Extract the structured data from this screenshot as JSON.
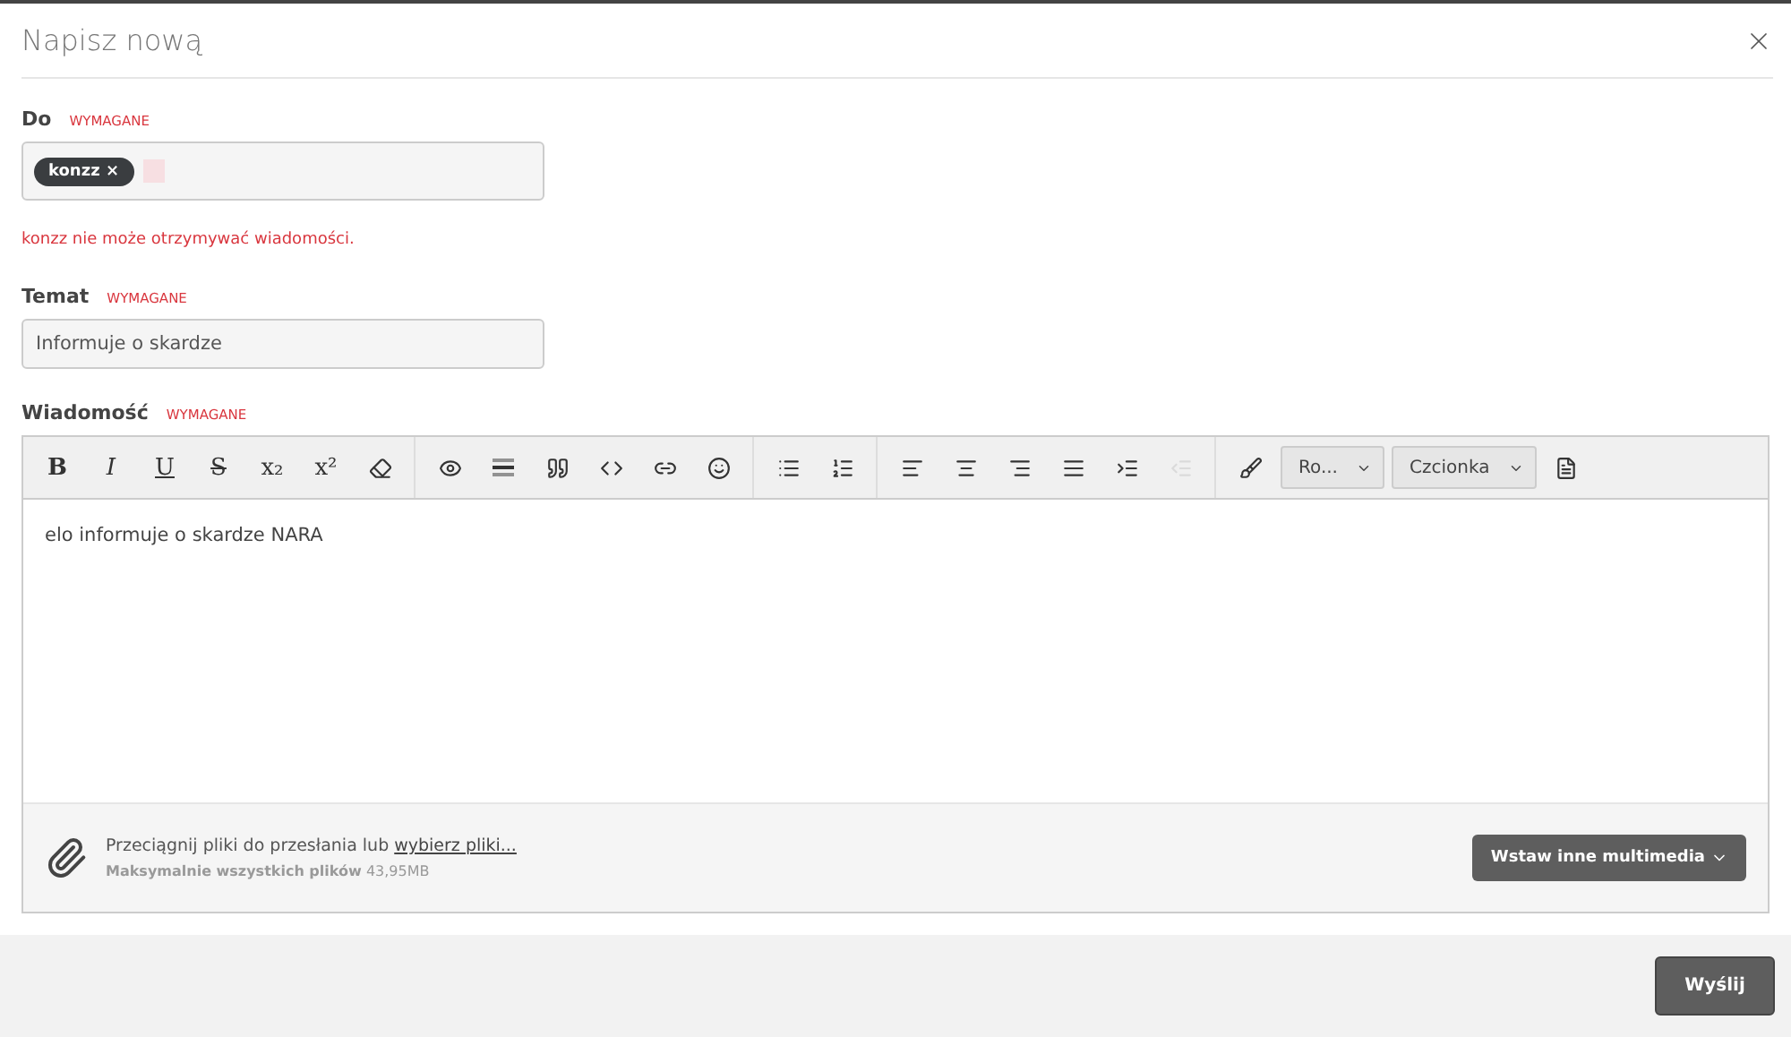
{
  "dialog": {
    "title": "Napisz nową"
  },
  "to": {
    "label": "Do",
    "required": "WYMAGANE",
    "chips": [
      {
        "label": "konzz ×"
      }
    ],
    "error": "konzz nie może otrzymywać wiadomości."
  },
  "subject": {
    "label": "Temat",
    "required": "WYMAGANE",
    "value": "Informuje o skardze"
  },
  "message": {
    "label": "Wiadomość",
    "required": "WYMAGANE",
    "toolbar": [
      [
        {
          "kind": "bold",
          "label": "B",
          "disabled": false
        },
        {
          "kind": "italic",
          "label": "I",
          "disabled": false
        },
        {
          "kind": "underline",
          "label": "U",
          "disabled": false
        },
        {
          "kind": "strike",
          "label": "S",
          "disabled": false
        },
        {
          "kind": "sub",
          "label": "x₂",
          "disabled": false
        },
        {
          "kind": "sup",
          "label": "x²",
          "disabled": false
        },
        {
          "kind": "eraser",
          "disabled": false
        }
      ],
      [
        {
          "kind": "eye",
          "disabled": false
        },
        {
          "kind": "rule",
          "disabled": false
        },
        {
          "kind": "quote",
          "disabled": false
        },
        {
          "kind": "code",
          "disabled": false
        },
        {
          "kind": "link",
          "disabled": false
        },
        {
          "kind": "smile",
          "disabled": false
        }
      ],
      [
        {
          "kind": "bullets",
          "disabled": false
        },
        {
          "kind": "numbers",
          "disabled": false
        }
      ],
      [
        {
          "kind": "left",
          "disabled": false
        },
        {
          "kind": "center",
          "disabled": false
        },
        {
          "kind": "right",
          "disabled": false
        },
        {
          "kind": "justify",
          "disabled": false
        },
        {
          "kind": "indent",
          "disabled": false
        },
        {
          "kind": "outdent",
          "disabled": true
        }
      ],
      [
        {
          "kind": "brush",
          "disabled": false
        },
        {
          "kind": "select",
          "label": "Ro...",
          "disabled": false
        },
        {
          "kind": "select",
          "label": "Czcionka",
          "disabled": false
        },
        {
          "kind": "doc",
          "disabled": false
        }
      ]
    ],
    "body": "elo informuje o skardze NARA",
    "attach": {
      "text": "Przeciągnij pliki do przesłania lub ",
      "link": "wybierz pliki...",
      "limit_label": "Maksymalnie wszystkich plików",
      "limit_value": "43,95MB",
      "button": "Wstaw inne multimedia"
    }
  },
  "footer": {
    "send": "Wyślij"
  }
}
